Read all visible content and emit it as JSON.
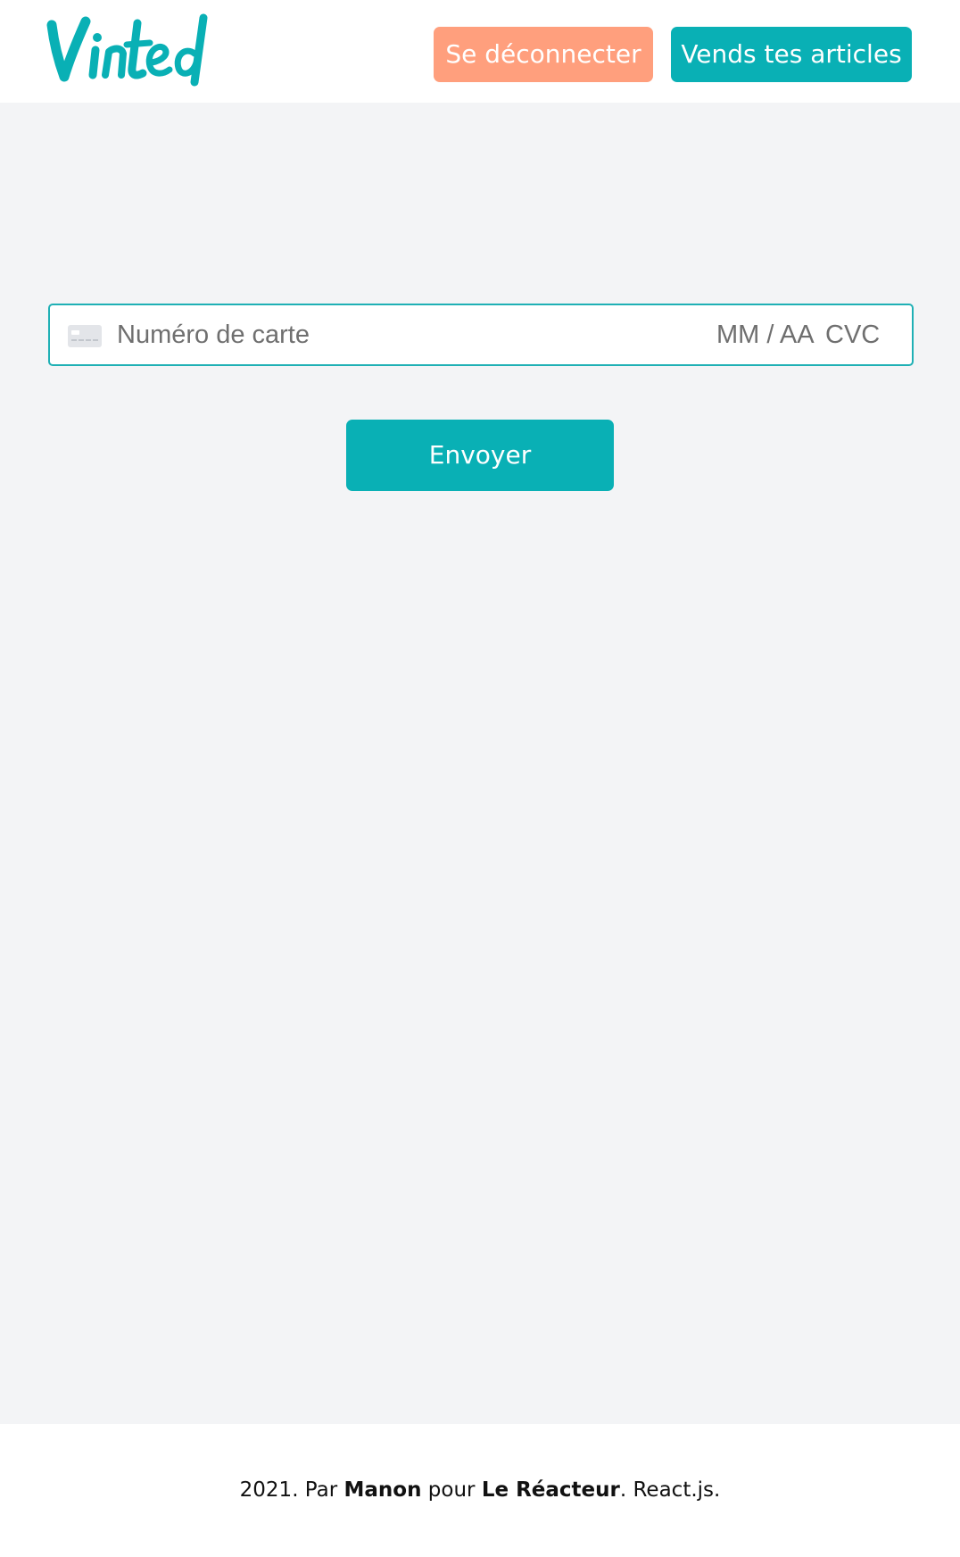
{
  "header": {
    "logo_text": "Vinted",
    "logout_label": "Se déconnecter",
    "sell_label": "Vends tes articles"
  },
  "payment": {
    "card_number_placeholder": "Numéro de carte",
    "expiry_placeholder": "MM / AA",
    "cvc_placeholder": "CVC",
    "submit_label": "Envoyer"
  },
  "footer": {
    "prefix": "2021. Par ",
    "author": "Manon",
    "middle": " pour ",
    "organization": "Le Réacteur",
    "suffix": ". React.js."
  },
  "colors": {
    "brand": "#09b0b5",
    "logout": "#ff9f7d",
    "background": "#f3f4f6"
  }
}
